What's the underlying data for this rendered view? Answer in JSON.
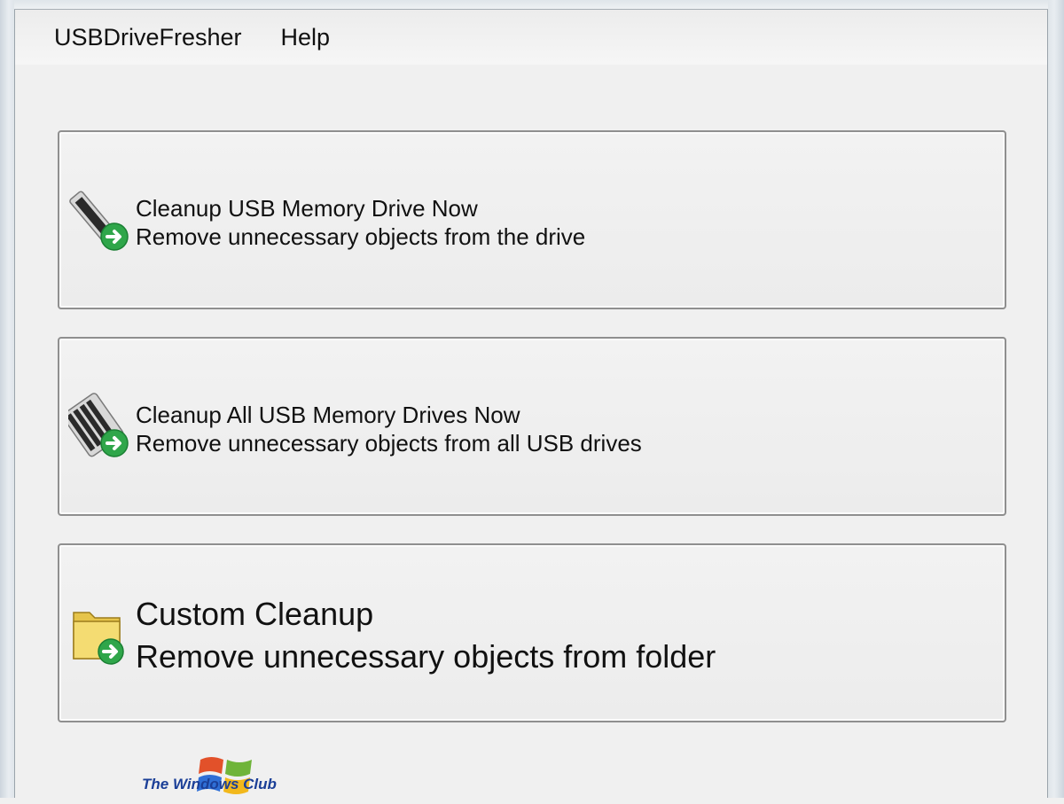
{
  "menubar": {
    "items": [
      {
        "label": "USBDriveFresher"
      },
      {
        "label": "Help"
      }
    ]
  },
  "actions": [
    {
      "title": "Cleanup USB Memory Drive Now",
      "subtitle": "Remove unnecessary objects from the drive",
      "icon": "usb-drive-icon"
    },
    {
      "title": "Cleanup All USB Memory Drives Now",
      "subtitle": "Remove unnecessary objects from all USB drives",
      "icon": "multiple-usb-drives-icon"
    },
    {
      "title": "Custom Cleanup",
      "subtitle": "Remove unnecessary objects from folder",
      "icon": "folder-icon"
    }
  ],
  "watermark": {
    "text": "The Windows Club",
    "icon": "windows-logo-icon"
  },
  "colors": {
    "arrow_badge": "#2fa64a",
    "logo_text": "#1b3f97"
  }
}
